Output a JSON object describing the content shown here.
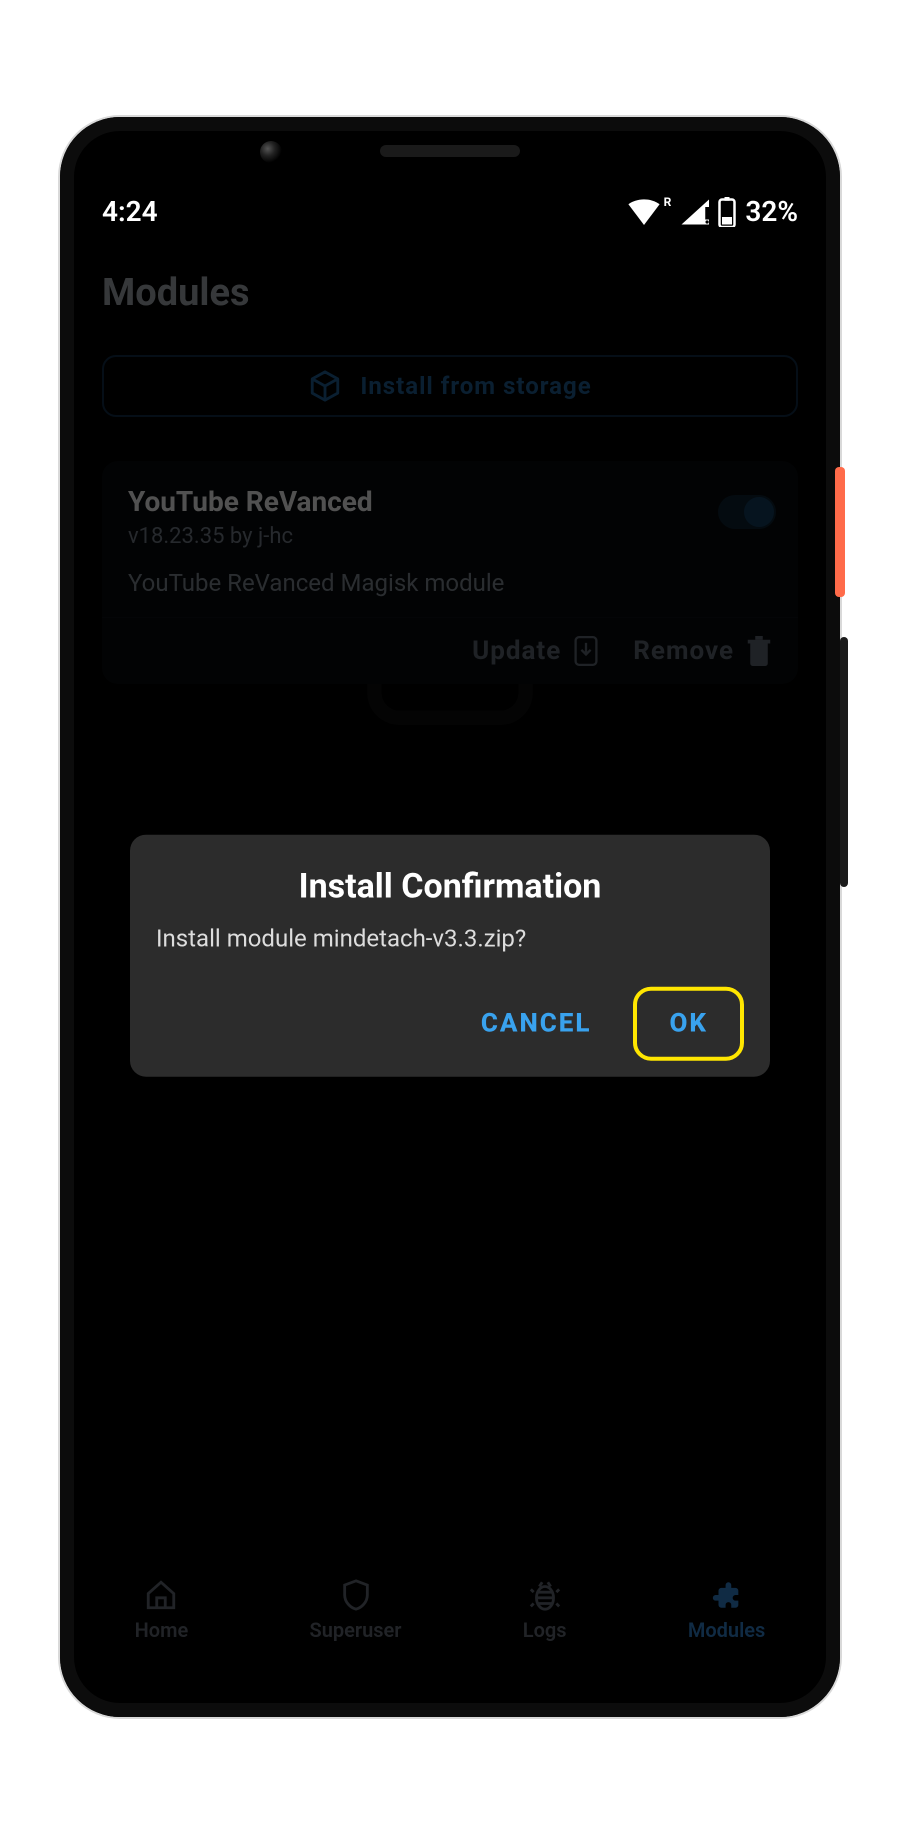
{
  "statusbar": {
    "time": "4:24",
    "battery": "32%"
  },
  "page": {
    "title": "Modules",
    "install_from_storage": "Install from storage"
  },
  "module": {
    "name": "YouTube ReVanced",
    "meta": "v18.23.35 by j-hc",
    "description": "YouTube ReVanced Magisk module",
    "enabled": true,
    "update_label": "Update",
    "remove_label": "Remove"
  },
  "dialog": {
    "title": "Install Confirmation",
    "message": "Install module mindetach-v3.3.zip?",
    "cancel": "CANCEL",
    "ok": "OK"
  },
  "nav": {
    "home": "Home",
    "superuser": "Superuser",
    "logs": "Logs",
    "modules": "Modules"
  },
  "colors": {
    "accent": "#39a2ee",
    "highlight": "#ffe600"
  }
}
